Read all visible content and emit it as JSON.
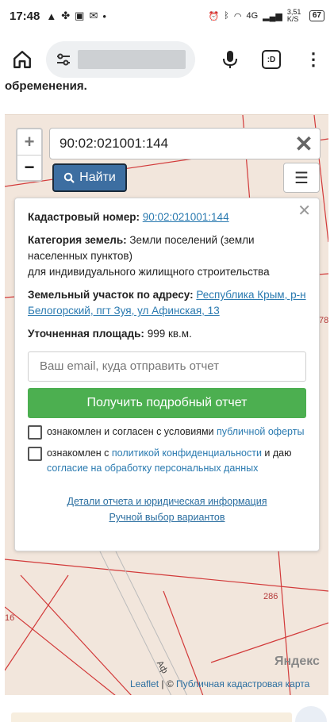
{
  "status_bar": {
    "time": "17:48",
    "left_icons": [
      "alert-icon",
      "apps-icon",
      "image-icon",
      "mail-icon",
      "dot-icon"
    ],
    "speed": "3,51 K/S",
    "battery": "67",
    "network": "4G"
  },
  "browser": {
    "tabs_label": ":D"
  },
  "page": {
    "heading": "обременения."
  },
  "map": {
    "search_value": "90:02:021001:144",
    "find_label": "Найти",
    "plot_numbers": [
      "78",
      "286",
      "16"
    ],
    "street_fragment": "Аф"
  },
  "popup": {
    "cadastral_label": "Кадастровый номер:",
    "cadastral_value": "90:02:021001:144",
    "category_label": "Категория земель:",
    "category_value": "Земли поселений (земли населенных пунктов)",
    "usage_value": "для индивидуального жилищного строительства",
    "address_label": "Земельный участок по адресу:",
    "address_value": "Республика Крым, р-н Белогорский, пгт Зуя, ул Афинская, 13",
    "area_label": "Уточненная площадь:",
    "area_value": "999 кв.м.",
    "email_placeholder": "Ваш email, куда отправить отчет",
    "report_button": "Получить подробный отчет",
    "consent1_text": "ознакомлен и согласен с условиями ",
    "consent1_link": "публичной оферты",
    "consent2_text1": "ознакомлен с ",
    "consent2_link1": "политикой конфиденциальности",
    "consent2_text2": " и даю ",
    "consent2_link2": "согласие на обработку персональных данных",
    "details_link": "Детали отчета и юридическая информация",
    "manual_link": "Ручной выбор вариантов"
  },
  "attribution": {
    "yandex": "Яндекс",
    "leaflet": "Leaflet",
    "separator": " | © ",
    "map_link": "Публичная кадастровая карта"
  }
}
